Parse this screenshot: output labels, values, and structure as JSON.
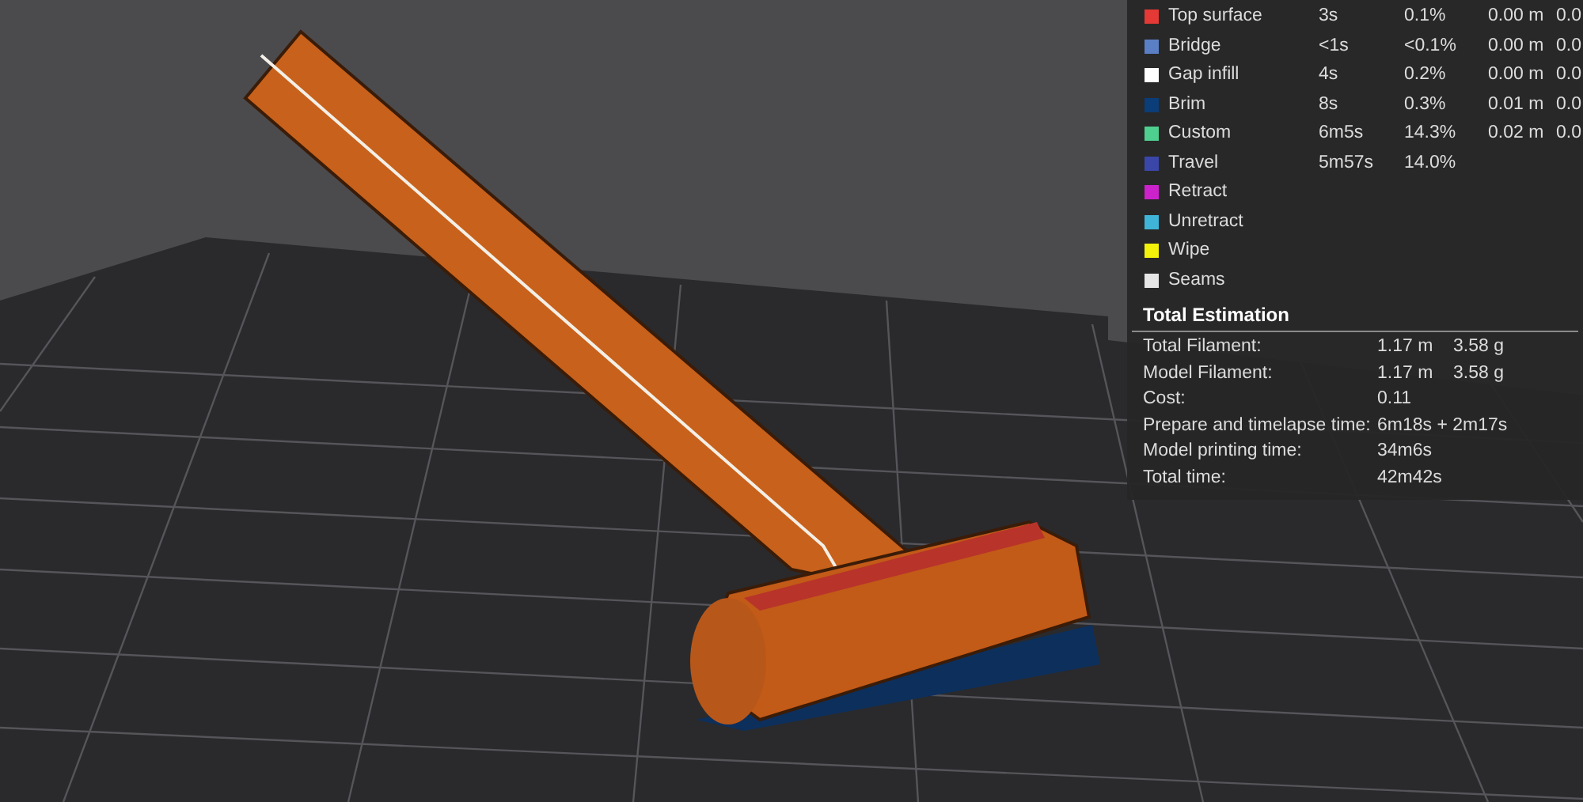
{
  "legend": {
    "rows": [
      {
        "color": "#e53935",
        "label": "Top surface",
        "time": "3s",
        "percent": "0.1%",
        "length": "0.00 m",
        "weight": "0.0"
      },
      {
        "color": "#5b7fc4",
        "label": "Bridge",
        "time": "<1s",
        "percent": "<0.1%",
        "length": "0.00 m",
        "weight": "0.0"
      },
      {
        "color": "#ffffff",
        "label": "Gap infill",
        "time": "4s",
        "percent": "0.2%",
        "length": "0.00 m",
        "weight": "0.0"
      },
      {
        "color": "#0b3d78",
        "label": "Brim",
        "time": "8s",
        "percent": "0.3%",
        "length": "0.01 m",
        "weight": "0.0"
      },
      {
        "color": "#4fcf8f",
        "label": "Custom",
        "time": "6m5s",
        "percent": "14.3%",
        "length": "0.02 m",
        "weight": "0.0"
      },
      {
        "color": "#3a47a8",
        "label": "Travel",
        "time": "5m57s",
        "percent": "14.0%"
      },
      {
        "color": "#cc22cc",
        "label": "Retract"
      },
      {
        "color": "#3fb4d8",
        "label": "Unretract"
      },
      {
        "color": "#f2f20a",
        "label": "Wipe"
      },
      {
        "color": "#e6e6e6",
        "label": "Seams"
      }
    ]
  },
  "total_estimation": {
    "title": "Total Estimation",
    "rows": [
      {
        "label": "Total Filament:",
        "values": [
          "1.17 m",
          "3.58 g"
        ]
      },
      {
        "label": "Model Filament:",
        "values": [
          "1.17 m",
          "3.58 g"
        ]
      },
      {
        "label": "Cost:",
        "values": [
          "0.11"
        ]
      },
      {
        "label": "Prepare and timelapse time:",
        "values": [
          "6m18s + 2m17s"
        ]
      },
      {
        "label": "Model printing time:",
        "values": [
          "34m6s"
        ]
      },
      {
        "label": "Total time:",
        "values": [
          "42m42s"
        ]
      }
    ]
  }
}
